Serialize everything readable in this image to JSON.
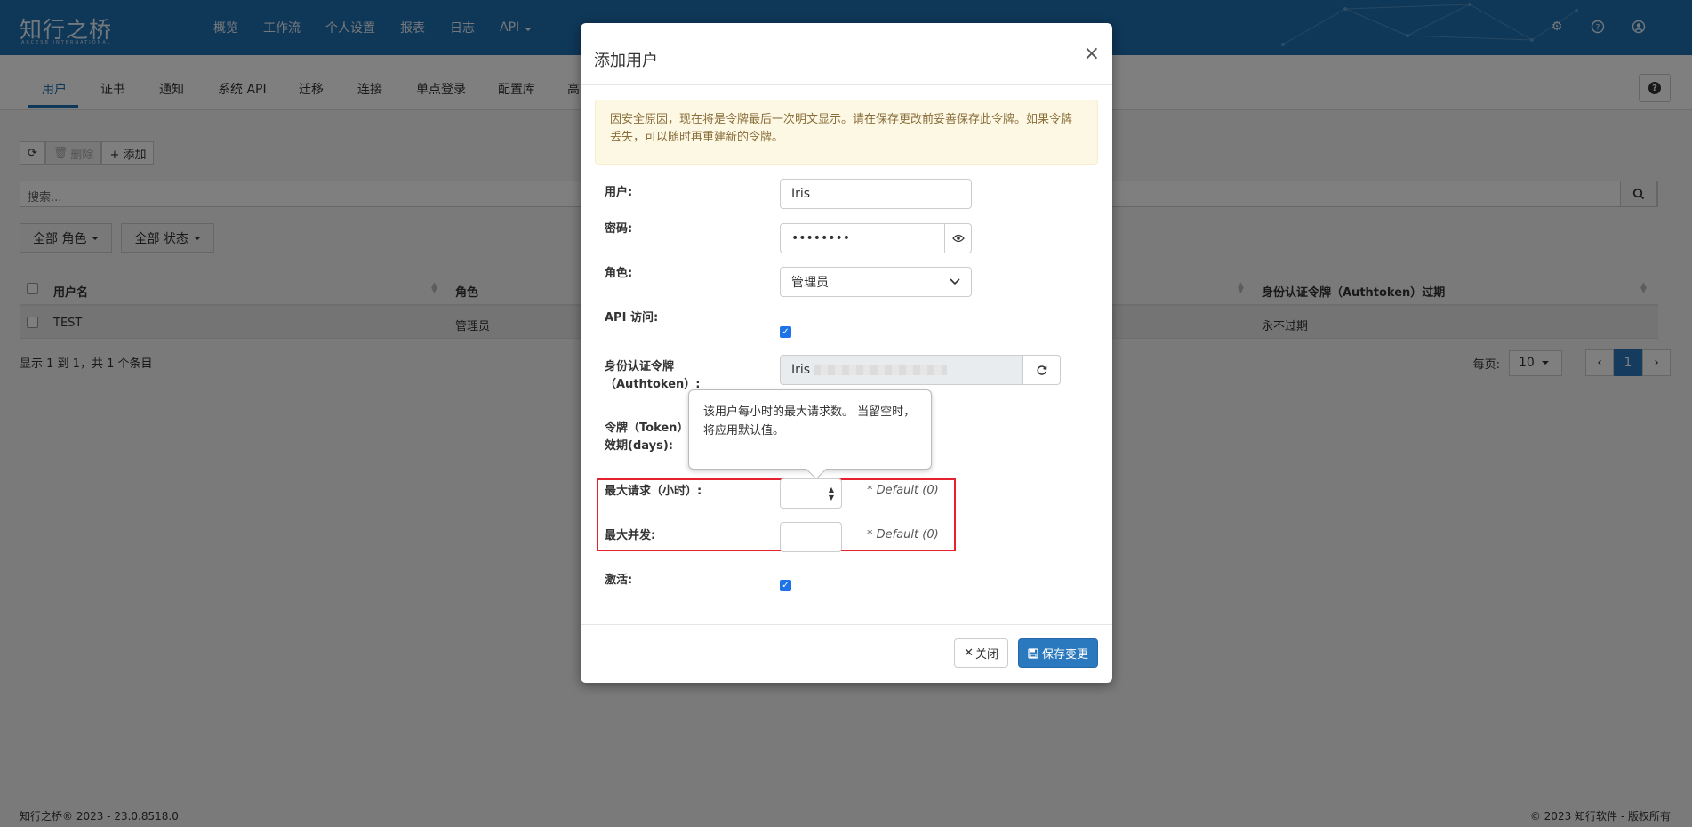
{
  "app": {
    "logo": "知行之桥",
    "logo_sub": "ARCESB INTERNATIONAL"
  },
  "topnav": {
    "items": [
      "概览",
      "工作流",
      "个人设置",
      "报表",
      "日志",
      "API"
    ]
  },
  "subtabs": [
    "用户",
    "证书",
    "通知",
    "系统 API",
    "迁移",
    "连接",
    "单点登录",
    "配置库",
    "高"
  ],
  "toolbar": {
    "delete_label": "删除",
    "add_label": "+ 添加"
  },
  "search": {
    "placeholder": "搜索..."
  },
  "filters": {
    "role": "全部 角色",
    "status": "全部 状态"
  },
  "table": {
    "headers": [
      "用户名",
      "角色",
      "身份认证令牌（Authtoken）过期"
    ],
    "rows": [
      {
        "username": "TEST",
        "role": "管理员",
        "expiry": "永不过期"
      }
    ],
    "info": "显示 1 到 1，共 1 个条目",
    "page_size_label": "每页:",
    "page_size": "10",
    "current_page": "1"
  },
  "footer": {
    "left": "知行之桥® 2023 - 23.0.8518.0",
    "right": "© 2023 知行软件 - 版权所有"
  },
  "modal": {
    "title": "添加用户",
    "alert": "因安全原因，现在将是令牌最后一次明文显示。请在保存更改前妥善保存此令牌。如果令牌丢失，可以随时再重建新的令牌。",
    "user_label": "用户:",
    "user_value": "Iris",
    "password_label": "密码:",
    "password_value": "••••••••",
    "role_label": "角色:",
    "role_value": "管理员",
    "api_access_label": "API 访问:",
    "api_access_checked": true,
    "authtoken_label": "身份认证令牌（Authtoken）:",
    "authtoken_value": "Iris",
    "token_expiry_label": "令牌（Token）有效期(days):",
    "max_requests_label": "最大请求（小时）:",
    "max_requests_hint": "* Default (0)",
    "max_concurrent_label": "最大并发:",
    "max_concurrent_hint": "* Default (0)",
    "active_label": "激活:",
    "active_checked": true,
    "tooltip": "该用户每小时的最大请求数。 当留空时，将应用默认值。",
    "close_button": "关闭",
    "save_button": "保存变更"
  }
}
